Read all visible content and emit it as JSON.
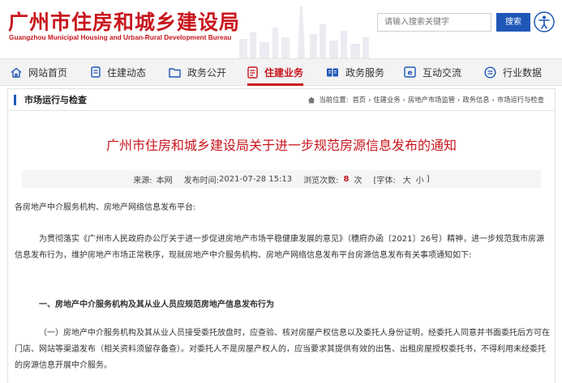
{
  "header": {
    "title": "广州市住房和城乡建设局",
    "subtitle": "Guangzhou Municipal Housing and Urban-Rural Development Bureau",
    "search_placeholder": "请输入搜索关键字",
    "search_button": "搜索"
  },
  "nav": {
    "items": [
      {
        "label": "网站首页",
        "icon": "home-icon"
      },
      {
        "label": "住建动态",
        "icon": "document-icon"
      },
      {
        "label": "政务公开",
        "icon": "folder-icon"
      },
      {
        "label": "住建业务",
        "icon": "business-document-icon",
        "active": true
      },
      {
        "label": "政务服务",
        "icon": "book-icon"
      },
      {
        "label": "互动交流",
        "icon": "e-icon"
      },
      {
        "label": "行业数据",
        "icon": "data-icon"
      }
    ],
    "active_color": "#c8161d"
  },
  "section": {
    "title": "市场运行与检查",
    "breadcrumb_prefix": "当前位置:",
    "breadcrumb": [
      "首页",
      "住建业务",
      "房地产市场监管",
      "政务信息",
      "市场运行与检查"
    ]
  },
  "article": {
    "title": "广州市住房和城乡建设局关于进一步规范房源信息发布的通知",
    "meta": {
      "source_label": "来源:",
      "source": "本网",
      "date_label": "发布时间:",
      "date": "2021-07-28 15:13",
      "views_label": "浏览次数:",
      "views": "8",
      "views_unit": "次",
      "font_label": "[字体:",
      "font_large": "大",
      "font_small": "小",
      "font_close": "]"
    },
    "salutation": "各房地产中介服务机构、房地产网络信息发布平台:",
    "paragraph1": "为贯彻落实《广州市人民政府办公厅关于进一步促进房地产市场平稳健康发展的意见》（穗府办函〔2021〕26号）精神，进一步规范我市房源信息发布行为，维护房地产市场正常秩序，现就房地产中介服务机构、房地产网络信息发布平台房源信息发布有关事项通知如下:",
    "heading1": "一、房地产中介服务机构及其从业人员应规范房地产信息发布行为",
    "paragraph2": "（一）房地产中介服务机构及其从业人员接受委托放盘时，应查验、核对房屋产权信息以及委托人身份证明，经委托人同意并书面委托后方可在门店、网站等渠道发布（相关资料须留存备查）。对委托人不是房屋产权人的，应当要求其提供有效的出售、出租房屋授权委托书，不得利用未经委托的房源信息开展中介服务。"
  },
  "colors": {
    "brand_red": "#c8161d",
    "accent_blue": "#1f57b8"
  }
}
